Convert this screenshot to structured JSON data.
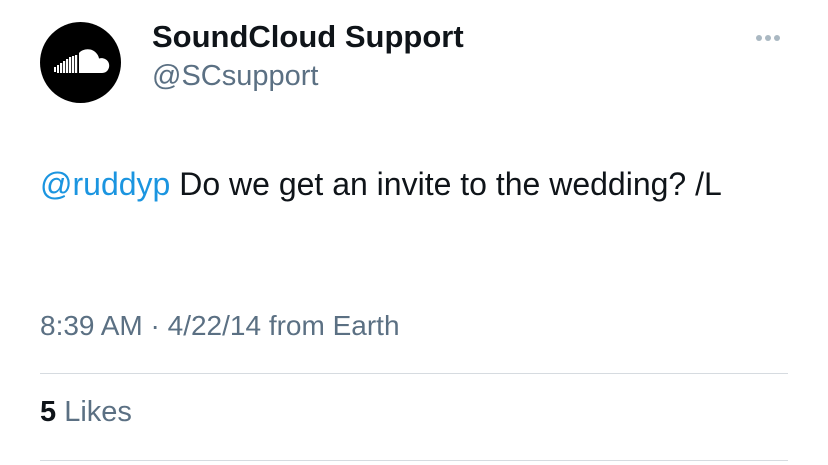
{
  "tweet": {
    "author": {
      "display_name": "SoundCloud Support",
      "handle": "@SCsupport",
      "avatar_icon": "soundcloud-logo-icon"
    },
    "more_icon": "more-options-icon",
    "mention": "@ruddyp",
    "text": " Do we get an invite to the wedding? /L",
    "time": "8:39 AM",
    "separator": "·",
    "date": "4/22/14",
    "source": "from Earth",
    "likes_count": "5",
    "likes_label": "Likes"
  },
  "colors": {
    "text": "#0f1419",
    "secondary": "#5b7083",
    "link": "#1b95e0",
    "avatar_bg": "#000000",
    "divider": "#d6dbe0"
  }
}
